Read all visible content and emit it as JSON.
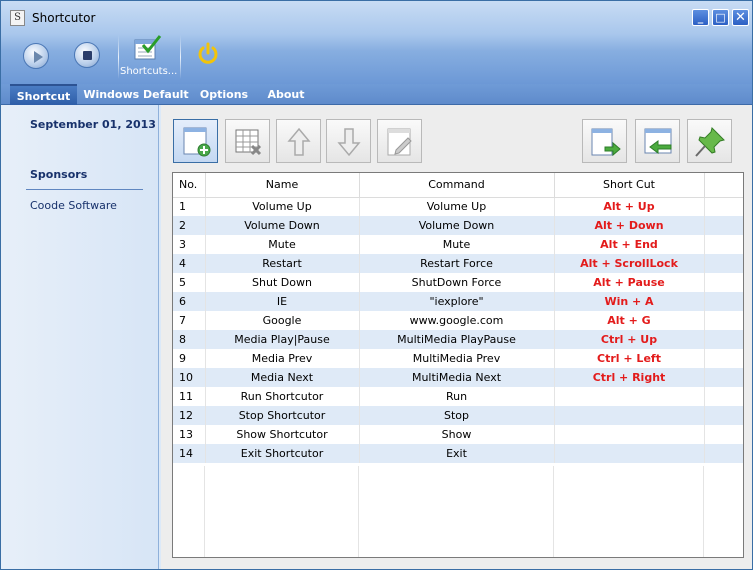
{
  "window": {
    "title": "Shortcutor",
    "icon_letter": "S"
  },
  "title_buttons": {
    "minimize": "_",
    "maximize": "□",
    "close": "✕"
  },
  "toolbar": {
    "shortcuts_label": "Shortcuts..."
  },
  "menu": {
    "items": [
      "Shortcut",
      "Windows Default",
      "Options",
      "About"
    ],
    "active": "Shortcut"
  },
  "sidebar": {
    "date": "September 01, 2013",
    "sponsors_title": "Sponsors",
    "sponsor_link": "Coode Software"
  },
  "table": {
    "headers": [
      "No.",
      "Name",
      "Command",
      "Short Cut"
    ],
    "rows": [
      {
        "no": "1",
        "name": "Volume Up",
        "command": "Volume Up",
        "shortcut": "Alt + Up"
      },
      {
        "no": "2",
        "name": "Volume Down",
        "command": "Volume Down",
        "shortcut": "Alt + Down"
      },
      {
        "no": "3",
        "name": "Mute",
        "command": "Mute",
        "shortcut": "Alt + End"
      },
      {
        "no": "4",
        "name": "Restart",
        "command": "Restart Force",
        "shortcut": "Alt + ScrollLock"
      },
      {
        "no": "5",
        "name": "Shut Down",
        "command": "ShutDown Force",
        "shortcut": "Alt + Pause"
      },
      {
        "no": "6",
        "name": "IE",
        "command": "\"iexplore\"",
        "shortcut": "Win + A"
      },
      {
        "no": "7",
        "name": "Google",
        "command": "www.google.com",
        "shortcut": "Alt + G"
      },
      {
        "no": "8",
        "name": "Media Play|Pause",
        "command": "MultiMedia PlayPause",
        "shortcut": "Ctrl + Up"
      },
      {
        "no": "9",
        "name": "Media Prev",
        "command": "MultiMedia Prev",
        "shortcut": "Ctrl + Left"
      },
      {
        "no": "10",
        "name": "Media Next",
        "command": "MultiMedia Next",
        "shortcut": "Ctrl + Right"
      },
      {
        "no": "11",
        "name": "Run Shortcutor",
        "command": "Run",
        "shortcut": ""
      },
      {
        "no": "12",
        "name": "Stop Shortcutor",
        "command": "Stop",
        "shortcut": ""
      },
      {
        "no": "13",
        "name": "Show Shortcutor",
        "command": "Show",
        "shortcut": ""
      },
      {
        "no": "14",
        "name": "Exit Shortcutor",
        "command": "Exit",
        "shortcut": ""
      }
    ]
  },
  "colors": {
    "accent": "#3a6ea5",
    "shortcut_text": "#e31b1b",
    "row_alt": "#dfeaf7"
  },
  "icons": [
    "play-icon",
    "stop-icon",
    "shortcuts-icon",
    "power-icon",
    "add-row-icon",
    "delete-row-icon",
    "move-up-icon",
    "move-down-icon",
    "edit-icon",
    "export-icon",
    "import-icon",
    "pin-icon"
  ]
}
